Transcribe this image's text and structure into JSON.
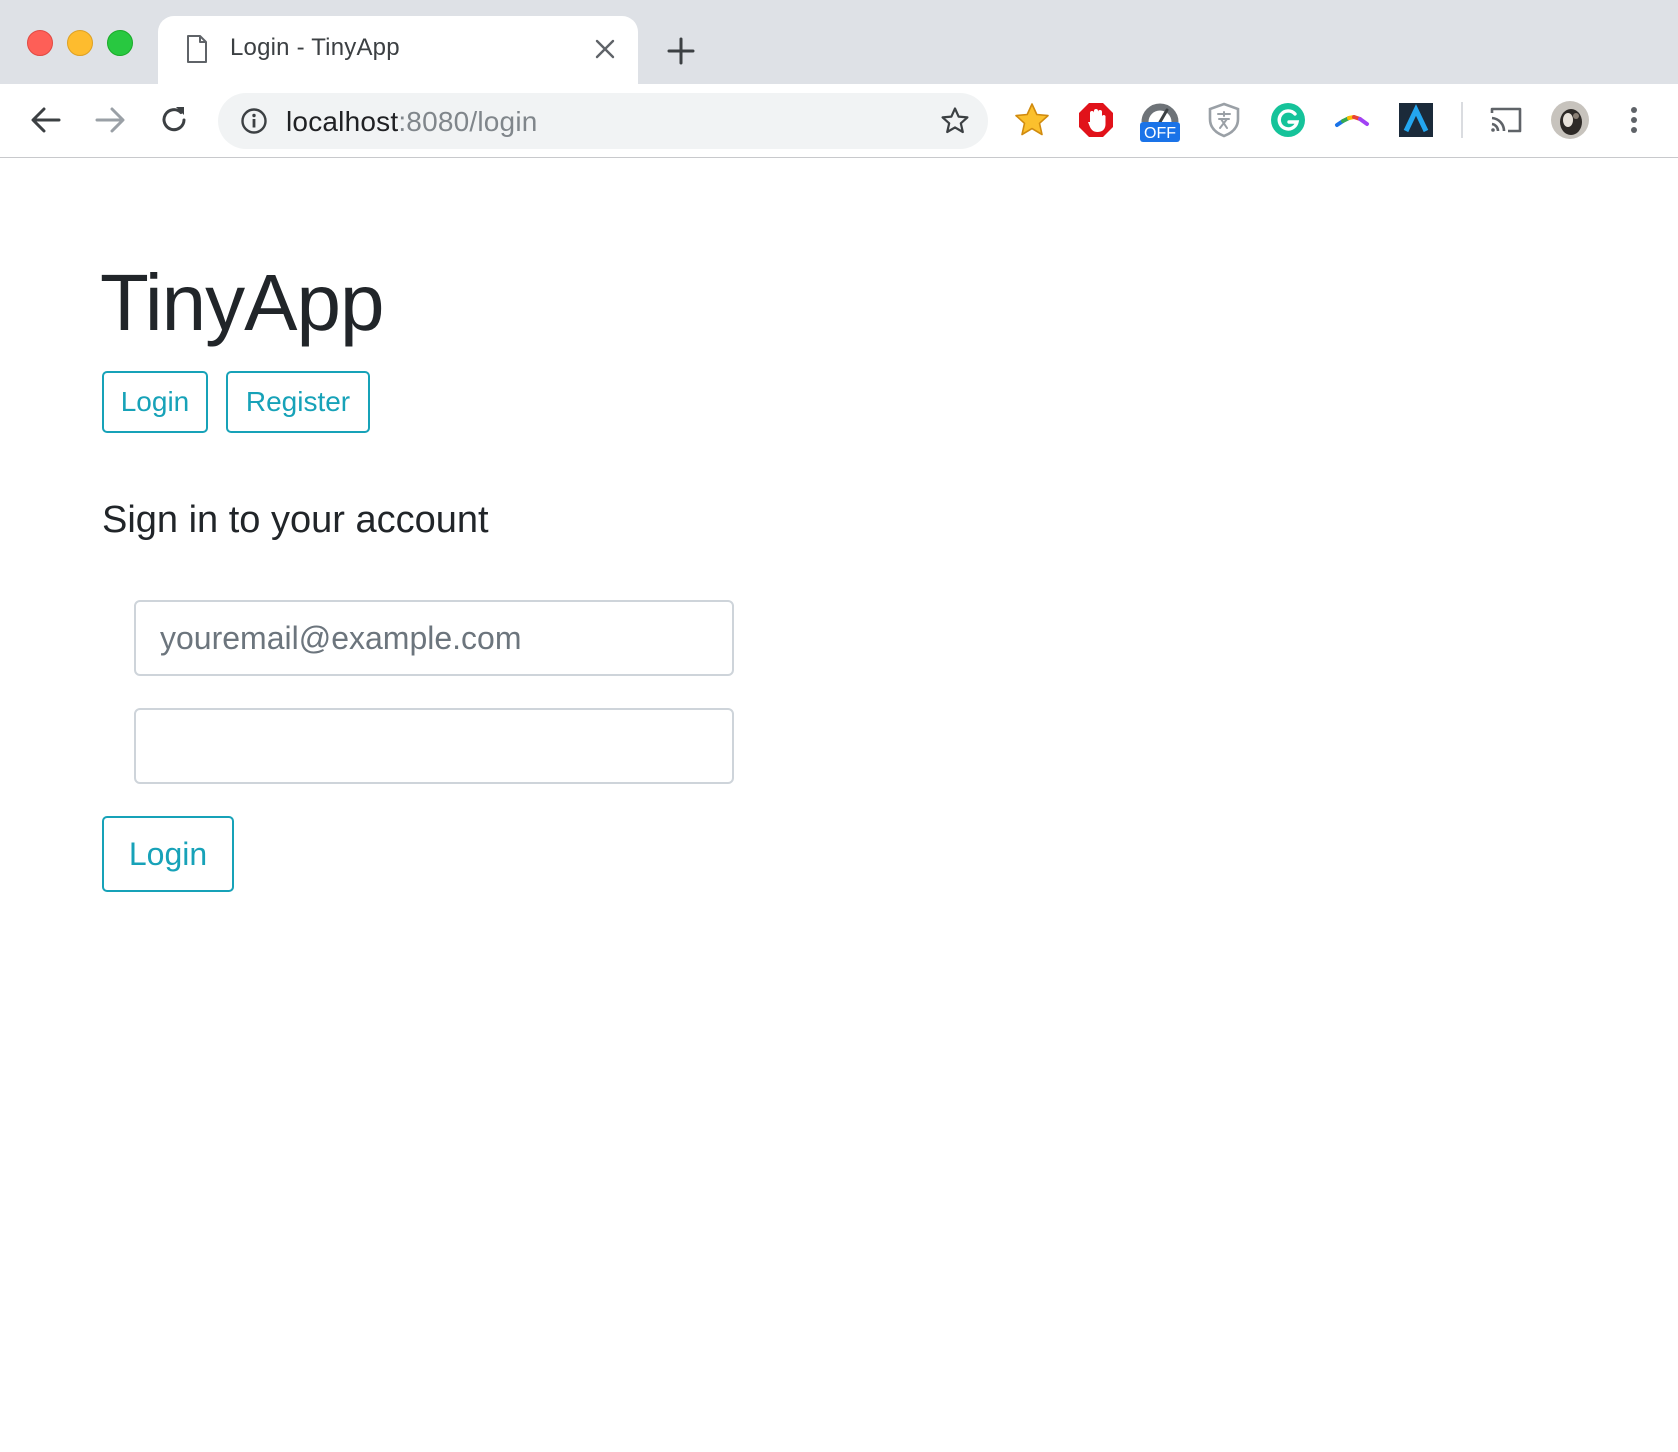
{
  "browser": {
    "tab": {
      "title": "Login - TinyApp"
    },
    "address_bar": {
      "host": "localhost",
      "rest": ":8080/login"
    },
    "extensions": [
      {
        "name": "star-extension-icon",
        "color": "#f6b21a"
      },
      {
        "name": "adblock-icon",
        "color": "#e1121a"
      },
      {
        "name": "speedometer-extension-icon",
        "badge": "OFF",
        "badge_color": "#1a73e8"
      },
      {
        "name": "shield-extension-icon",
        "color": "#9aa0a6"
      },
      {
        "name": "grammarly-icon",
        "color": "#15c39a"
      },
      {
        "name": "rainbow-extension-icon"
      },
      {
        "name": "a-logo-extension-icon",
        "color": "#1b2a3a"
      },
      {
        "name": "cast-icon"
      },
      {
        "name": "profile-avatar"
      },
      {
        "name": "kebab-menu-icon"
      }
    ]
  },
  "page": {
    "brand": "TinyApp",
    "nav": {
      "login_label": "Login",
      "register_label": "Register"
    },
    "heading": "Sign in to your account",
    "form": {
      "email_placeholder": "youremail@example.com",
      "password_value": "",
      "submit_label": "Login"
    }
  },
  "colors": {
    "accent": "#17a2b8",
    "text": "#212529",
    "border": "#ced4da"
  }
}
